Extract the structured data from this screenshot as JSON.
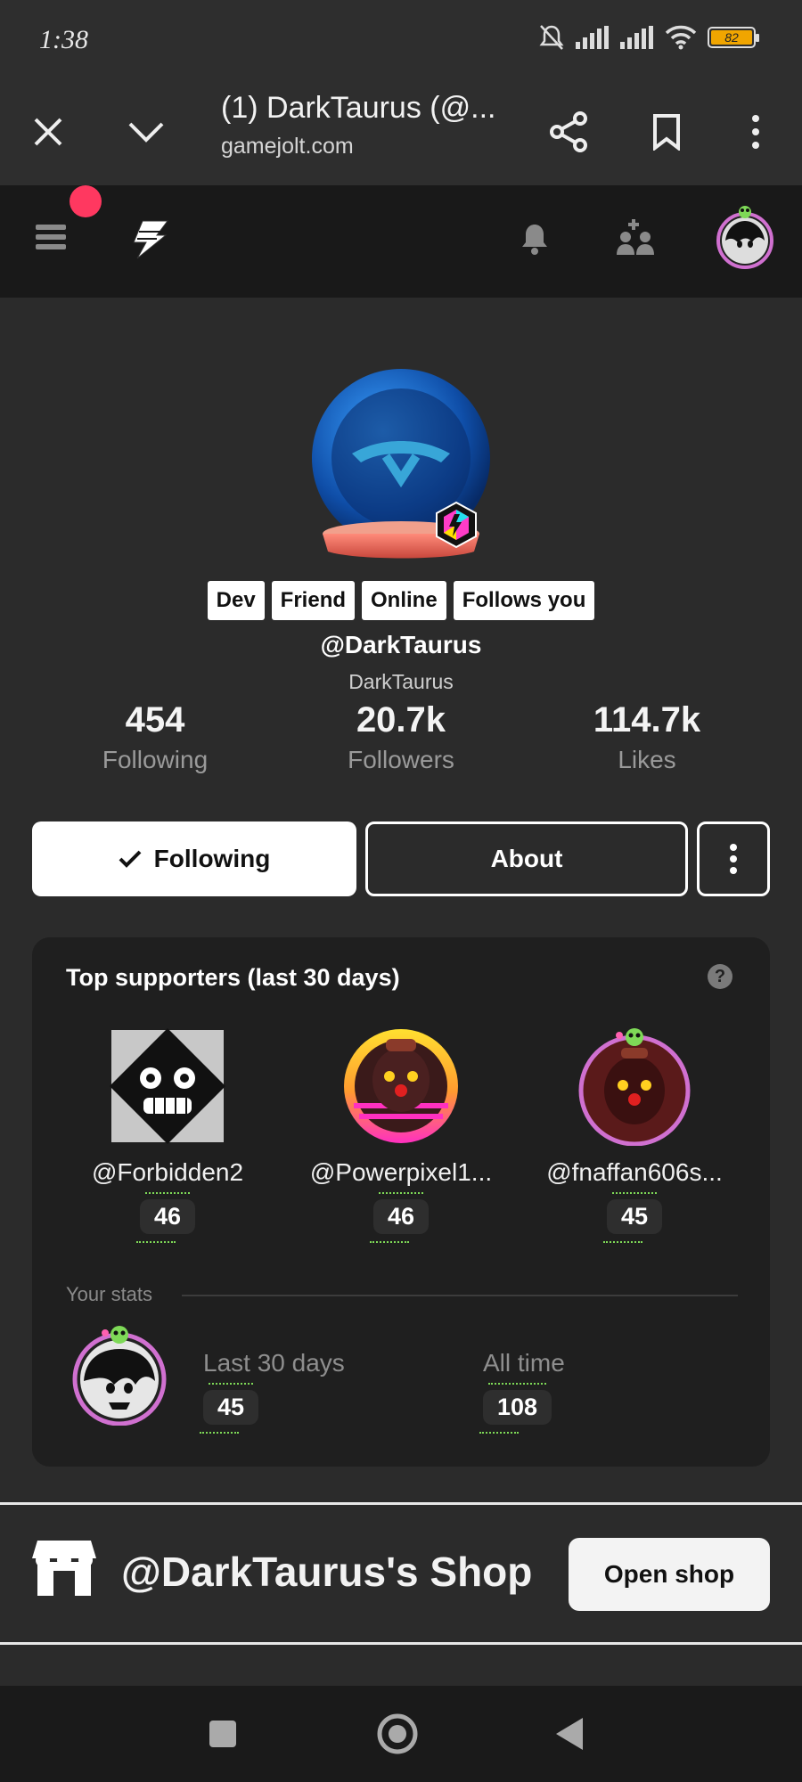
{
  "status_bar": {
    "time": "1:38",
    "battery": "82"
  },
  "browser": {
    "title": "(1) DarkTaurus (@...",
    "url": "gamejolt.com"
  },
  "profile": {
    "tags": [
      "Dev",
      "Friend",
      "Online",
      "Follows you"
    ],
    "handle": "@DarkTaurus",
    "display_name": "DarkTaurus",
    "stats": [
      {
        "value": "454",
        "label": "Following"
      },
      {
        "value": "20.7k",
        "label": "Followers"
      },
      {
        "value": "114.7k",
        "label": "Likes"
      }
    ],
    "buttons": {
      "following": "Following",
      "about": "About"
    }
  },
  "supporters": {
    "title": "Top supporters (last 30 days)",
    "help": "?",
    "items": [
      {
        "name": "@Forbidden2",
        "count": "46"
      },
      {
        "name": "@Powerpixel1...",
        "count": "46"
      },
      {
        "name": "@fnaffan606s...",
        "count": "45"
      }
    ],
    "your_stats": {
      "label": "Your stats",
      "last30_label": "Last 30 days",
      "last30_value": "45",
      "alltime_label": "All time",
      "alltime_value": "108"
    }
  },
  "shop": {
    "title": "@DarkTaurus's Shop",
    "button": "Open shop"
  },
  "icons": {
    "close": "close-icon",
    "chevron": "chevron-down-icon",
    "share": "share-icon",
    "bookmark": "bookmark-icon",
    "more": "more-vertical-icon",
    "menu": "hamburger-icon",
    "logo": "gamejolt-bolt-icon",
    "bell": "bell-icon",
    "friends": "add-friend-icon",
    "store": "store-icon"
  },
  "colors": {
    "accent_red": "#ff3860",
    "grass": "#7ed957",
    "battery": "#f0a500"
  }
}
